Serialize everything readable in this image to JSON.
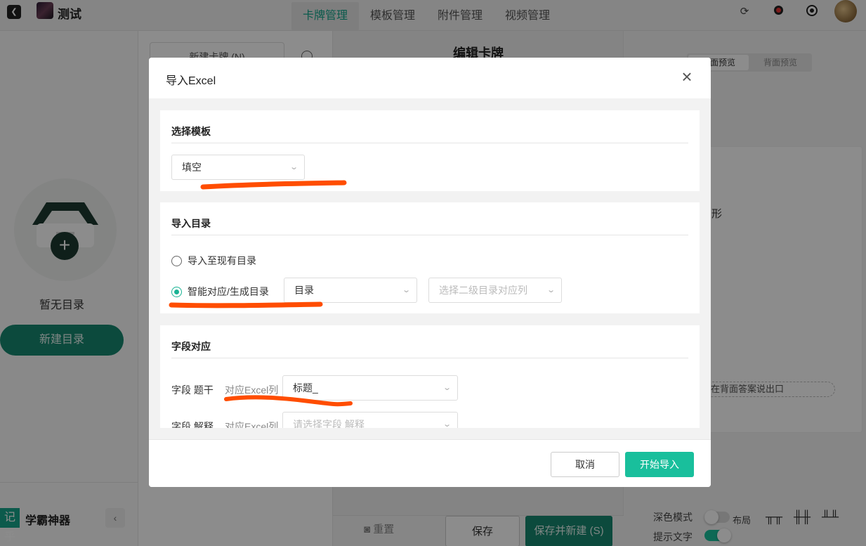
{
  "app": {
    "title": "测试"
  },
  "nav": {
    "tabs": [
      {
        "label": "卡牌管理"
      },
      {
        "label": "模板管理"
      },
      {
        "label": "附件管理"
      },
      {
        "label": "视频管理"
      }
    ]
  },
  "sidebar": {
    "empty_text": "暂无目录",
    "new_dir_label": "新建目录",
    "brand_logo": "记乎",
    "brand_name": "学霸神器"
  },
  "card_list": {
    "new_card_label": "新建卡牌 (N)"
  },
  "editor": {
    "title": "编辑卡牌",
    "reset_label": "重置",
    "save_label": "保存",
    "save_new_label": "保存并新建 (S)"
  },
  "preview": {
    "front_label": "正面预览",
    "back_label": "背面预览",
    "card_text": "形",
    "pill_text": "在背面答案说出口",
    "dark_mode_label": "深色模式",
    "layout_label": "布局",
    "hint_text_label": "提示文字"
  },
  "modal": {
    "title": "导入Excel",
    "template_section": {
      "title": "选择模板",
      "selected": "填空"
    },
    "directory_section": {
      "title": "导入目录",
      "option_existing": "导入至现有目录",
      "option_smart": "智能对应/生成目录",
      "directory_select": "目录",
      "secondary_placeholder": "选择二级目录对应列"
    },
    "field_section": {
      "title": "字段对应",
      "rows": [
        {
          "label": "字段 题干",
          "sub": "对应Excel列",
          "value": "标题_"
        },
        {
          "label": "字段 解释",
          "sub": "对应Excel列",
          "placeholder": "请选择字段 解释"
        }
      ]
    },
    "cancel_label": "取消",
    "import_label": "开始导入"
  },
  "colors": {
    "accent": "#19bf9c",
    "accent_dark": "#17876f",
    "annotation": "#ff4d00"
  }
}
